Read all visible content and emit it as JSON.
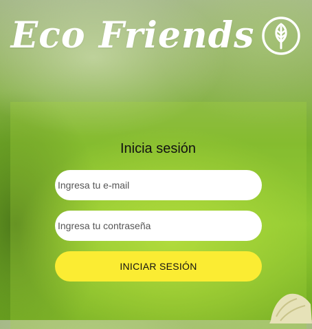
{
  "brand": {
    "title": "Eco Friends",
    "icon": "tree-in-circle-icon"
  },
  "login": {
    "title": "Inicia sesión",
    "email_placeholder": "Ingresa tu e-mail",
    "password_placeholder": "Ingresa tu contraseña",
    "submit_label": "INICIAR SESIÓN"
  },
  "colors": {
    "accent_button": "#fbec33",
    "brand_text": "#ffffff",
    "background_green": "#8cc730"
  }
}
